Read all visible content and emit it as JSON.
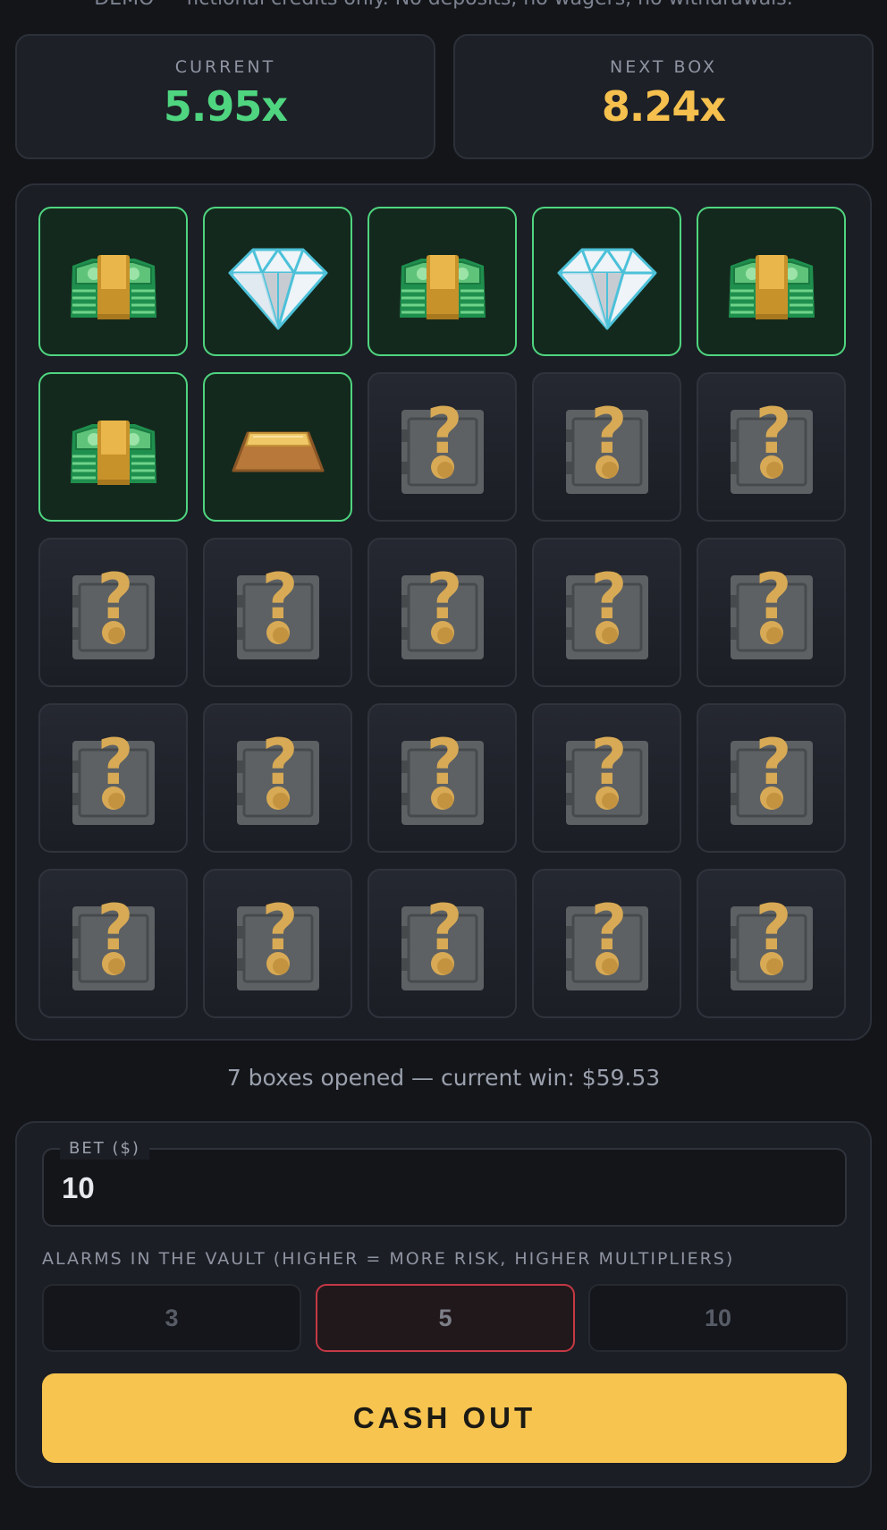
{
  "disclaimer": "DEMO — fictional credits only. No deposits, no wagers, no withdrawals.",
  "stats": {
    "current_label": "CURRENT",
    "current_value": "5.95x",
    "next_label": "NEXT BOX",
    "next_value": "8.24x"
  },
  "colors": {
    "current_accent": "#4fd580",
    "next_accent": "#f5c04e",
    "revealed_border": "#4fd580",
    "selected_alarm_border": "#c43945",
    "cashout_bg": "#f6c44f"
  },
  "grid": {
    "tiles": [
      {
        "state": "revealed",
        "icon": "cash-stack-icon"
      },
      {
        "state": "revealed",
        "icon": "diamond-icon"
      },
      {
        "state": "revealed",
        "icon": "cash-stack-icon"
      },
      {
        "state": "revealed",
        "icon": "diamond-icon"
      },
      {
        "state": "revealed",
        "icon": "cash-stack-icon"
      },
      {
        "state": "revealed",
        "icon": "cash-stack-icon"
      },
      {
        "state": "revealed",
        "icon": "gold-bar-icon"
      },
      {
        "state": "hidden",
        "icon": "mystery-safe-icon"
      },
      {
        "state": "hidden",
        "icon": "mystery-safe-icon"
      },
      {
        "state": "hidden",
        "icon": "mystery-safe-icon"
      },
      {
        "state": "hidden",
        "icon": "mystery-safe-icon"
      },
      {
        "state": "hidden",
        "icon": "mystery-safe-icon"
      },
      {
        "state": "hidden",
        "icon": "mystery-safe-icon"
      },
      {
        "state": "hidden",
        "icon": "mystery-safe-icon"
      },
      {
        "state": "hidden",
        "icon": "mystery-safe-icon"
      },
      {
        "state": "hidden",
        "icon": "mystery-safe-icon"
      },
      {
        "state": "hidden",
        "icon": "mystery-safe-icon"
      },
      {
        "state": "hidden",
        "icon": "mystery-safe-icon"
      },
      {
        "state": "hidden",
        "icon": "mystery-safe-icon"
      },
      {
        "state": "hidden",
        "icon": "mystery-safe-icon"
      },
      {
        "state": "hidden",
        "icon": "mystery-safe-icon"
      },
      {
        "state": "hidden",
        "icon": "mystery-safe-icon"
      },
      {
        "state": "hidden",
        "icon": "mystery-safe-icon"
      },
      {
        "state": "hidden",
        "icon": "mystery-safe-icon"
      },
      {
        "state": "hidden",
        "icon": "mystery-safe-icon"
      }
    ]
  },
  "status_text": "7 boxes opened — current win: $59.53",
  "bet": {
    "label": "BET ($)",
    "value": "10"
  },
  "alarms": {
    "label": "ALARMS IN THE VAULT (HIGHER = MORE RISK, HIGHER MULTIPLIERS)",
    "options": [
      "3",
      "5",
      "10"
    ],
    "selected": "5"
  },
  "cashout_label": "CASH OUT"
}
